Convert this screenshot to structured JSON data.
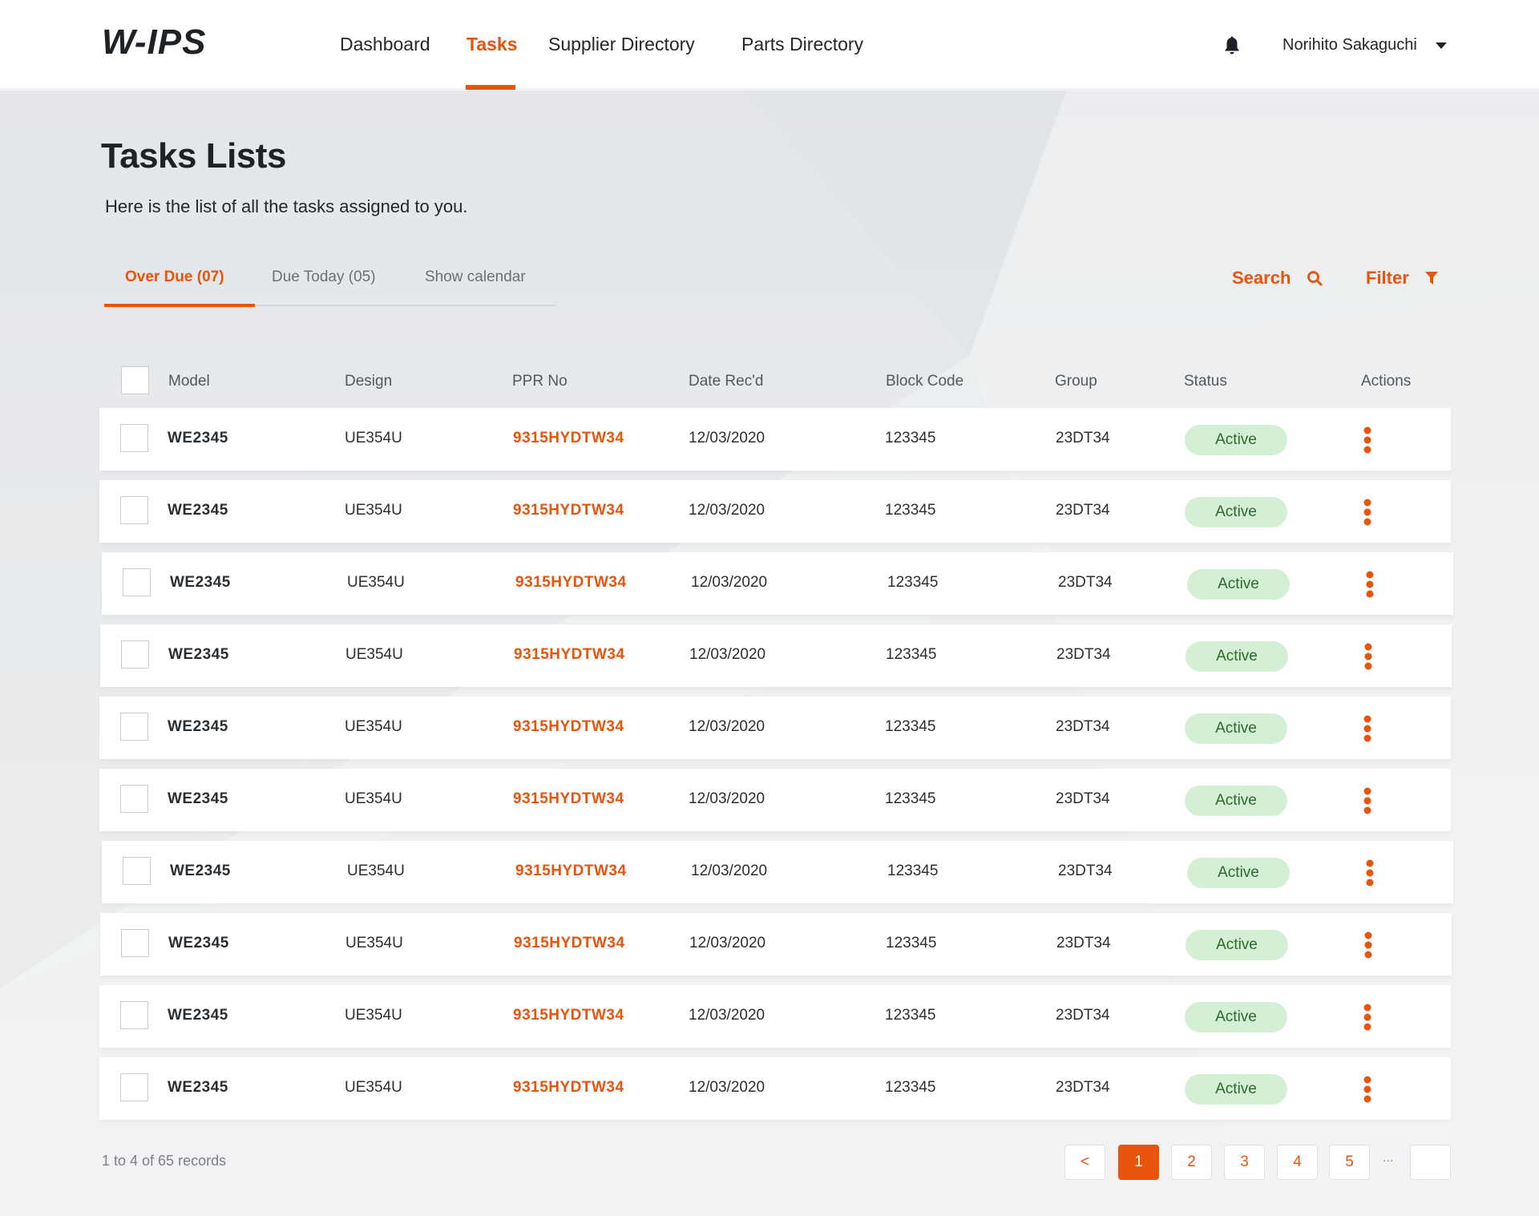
{
  "app": {
    "logo": "W-IPS",
    "accent_color": "#e8540c"
  },
  "nav": {
    "items": [
      {
        "label": "Dashboard",
        "active": false
      },
      {
        "label": "Tasks",
        "active": true
      },
      {
        "label": "Supplier Directory",
        "active": false
      },
      {
        "label": "Parts Directory",
        "active": false
      }
    ]
  },
  "user": {
    "name": "Norihito Sakaguchi",
    "notification_icon": "bell-icon",
    "menu_icon": "caret-down-icon"
  },
  "page": {
    "title": "Tasks Lists",
    "subtitle": "Here is the list of all the tasks assigned to you."
  },
  "tabs": [
    {
      "label": "Over Due (07)",
      "active": true
    },
    {
      "label": "Due Today (05)",
      "active": false
    },
    {
      "label": "Show calendar",
      "active": false
    }
  ],
  "toolbar": {
    "search_label": "Search",
    "search_icon": "search-icon",
    "filter_label": "Filter",
    "filter_icon": "filter-icon"
  },
  "table": {
    "columns": [
      "Model",
      "Design",
      "PPR No",
      "Date Rec'd",
      "Block Code",
      "Group",
      "Status",
      "Actions"
    ],
    "rows": [
      {
        "model": "WE2345",
        "design": "UE354U",
        "ppr": "9315HYDTW34",
        "date": "12/03/2020",
        "block": "123345",
        "group": "23DT34",
        "status": "Active"
      },
      {
        "model": "WE2345",
        "design": "UE354U",
        "ppr": "9315HYDTW34",
        "date": "12/03/2020",
        "block": "123345",
        "group": "23DT34",
        "status": "Active"
      },
      {
        "model": "WE2345",
        "design": "UE354U",
        "ppr": "9315HYDTW34",
        "date": "12/03/2020",
        "block": "123345",
        "group": "23DT34",
        "status": "Active"
      },
      {
        "model": "WE2345",
        "design": "UE354U",
        "ppr": "9315HYDTW34",
        "date": "12/03/2020",
        "block": "123345",
        "group": "23DT34",
        "status": "Active"
      },
      {
        "model": "WE2345",
        "design": "UE354U",
        "ppr": "9315HYDTW34",
        "date": "12/03/2020",
        "block": "123345",
        "group": "23DT34",
        "status": "Active"
      },
      {
        "model": "WE2345",
        "design": "UE354U",
        "ppr": "9315HYDTW34",
        "date": "12/03/2020",
        "block": "123345",
        "group": "23DT34",
        "status": "Active"
      },
      {
        "model": "WE2345",
        "design": "UE354U",
        "ppr": "9315HYDTW34",
        "date": "12/03/2020",
        "block": "123345",
        "group": "23DT34",
        "status": "Active"
      },
      {
        "model": "WE2345",
        "design": "UE354U",
        "ppr": "9315HYDTW34",
        "date": "12/03/2020",
        "block": "123345",
        "group": "23DT34",
        "status": "Active"
      },
      {
        "model": "WE2345",
        "design": "UE354U",
        "ppr": "9315HYDTW34",
        "date": "12/03/2020",
        "block": "123345",
        "group": "23DT34",
        "status": "Active"
      },
      {
        "model": "WE2345",
        "design": "UE354U",
        "ppr": "9315HYDTW34",
        "date": "12/03/2020",
        "block": "123345",
        "group": "23DT34",
        "status": "Active"
      }
    ],
    "status_colors": {
      "Active": {
        "bg": "#d3efd4",
        "fg": "#2e6a2f"
      }
    }
  },
  "footer": {
    "records_text": "1 to 4 of 65 records",
    "pagination": {
      "prev_label": "<",
      "pages": [
        "1",
        "2",
        "3",
        "4",
        "5"
      ],
      "current": "1",
      "ellipsis": "...",
      "last_label": ""
    }
  }
}
